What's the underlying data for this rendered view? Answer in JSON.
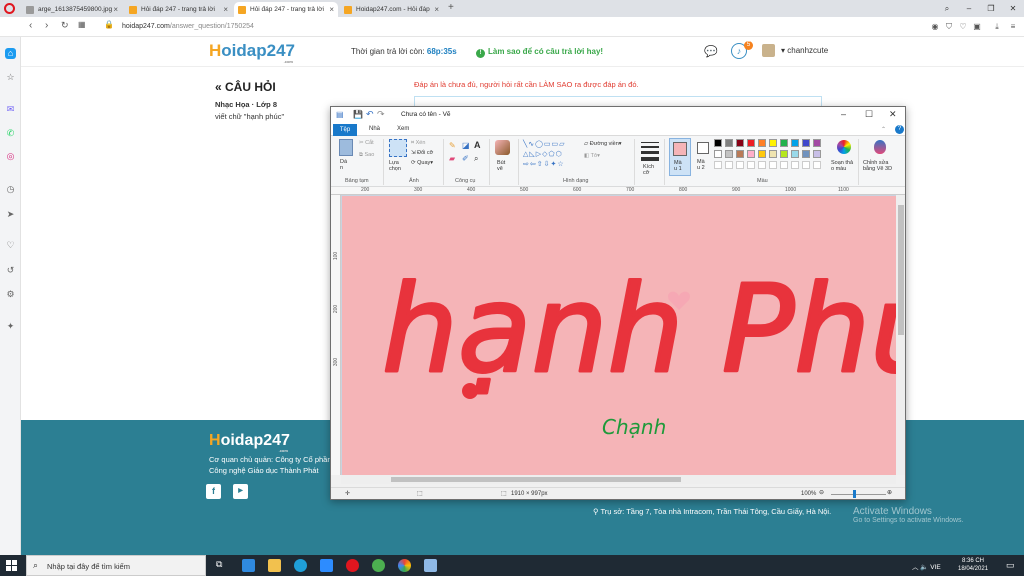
{
  "browser": {
    "tabs": [
      {
        "label": "arge_1613875459800.jpg",
        "active": false
      },
      {
        "label": "Hỏi đáp 247 - trang trả lời",
        "active": false
      },
      {
        "label": "Hỏi đáp 247 - trang trả lời",
        "active": true
      },
      {
        "label": "Hoidap247.com - Hỏi đáp",
        "active": false
      }
    ],
    "url_domain": "hoidap247.com",
    "url_path": "/answer_question/1750254"
  },
  "site": {
    "logo_h": "H",
    "logo_rest": "oidap247",
    "logo_com": ".com",
    "timer_label": "Thời gian trả lời còn:",
    "timer_value": "68p:35s",
    "tip": "Làm sao để có câu trả lời hay!",
    "notification_count": "5",
    "username": "chanhzcute"
  },
  "question": {
    "section_title": "CÂU HỎI",
    "subject": "Nhạc Họa · Lớp 8",
    "text": "viết chữ \"hạnh phúc\"",
    "warning": "Đáp án là chưa đủ, người hỏi rất cần LÀM SAO ra được đáp án đó."
  },
  "footer": {
    "logo_h": "H",
    "logo_rest": "oidap247",
    "logo_com": ".com",
    "owner": "Cơ quan chủ quản: Công ty Cổ phần Công nghệ Giáo dục Thành Phát",
    "address": "Trụ sở: Tầng 7, Tòa nhà Intracom, Trần Thái Tông, Cầu Giấy, Hà Nội.",
    "activate_title": "Activate Windows",
    "activate_sub": "Go to Settings to activate Windows."
  },
  "paint": {
    "title": "Chưa có tên - Vẽ",
    "tabs": {
      "file": "Tệp",
      "home": "Nhà",
      "view": "Xem"
    },
    "ribbon": {
      "paste": "Dá\nn",
      "cut": "Cắt",
      "copy": "Sao",
      "select": "Lựa\nchọn",
      "crop": "Xén",
      "resize": "Đổi cỡ",
      "rotate": "Quay",
      "brushes": "Bút\nvẽ",
      "outline": "Đường viền",
      "fill": "Tô",
      "size": "Kích\ncỡ",
      "color1": "Mà\nu 1",
      "color2": "Mà\nu 2",
      "edit_colors": "Soạn thả\no màu",
      "paint3d": "Chỉnh sửa\nbằng Vẽ 3D",
      "group_clipboard": "Bảng tạm",
      "group_image": "Ảnh",
      "group_tools": "Công cụ",
      "group_shapes": "Hình dạng",
      "group_colors": "Màu"
    },
    "ruler_ticks": [
      "200",
      "300",
      "400",
      "500",
      "600",
      "700",
      "800",
      "900",
      "1000",
      "1100"
    ],
    "vruler_ticks": [
      "100",
      "200",
      "300"
    ],
    "canvas_text": "hạnh Phúc",
    "signature": "Chạnh",
    "canvas_size": "1910 × 997px",
    "zoom": "100%",
    "palette_row1": [
      "#000000",
      "#7f7f7f",
      "#880015",
      "#ed1c24",
      "#ff7f27",
      "#fff200",
      "#22b14c",
      "#00a2e8",
      "#3f48cc",
      "#a349a4"
    ],
    "palette_row2": [
      "#ffffff",
      "#c3c3c3",
      "#b97a57",
      "#ffaec9",
      "#ffc90e",
      "#efe4b0",
      "#b5e61d",
      "#99d9ea",
      "#7092be",
      "#c8bfe7"
    ],
    "color1_value": "#f5b4b7",
    "color2_value": "#ffffff",
    "ink_color": "#e8333c",
    "signature_color": "#1e9a3a",
    "canvas_color": "#f5b4b7"
  },
  "taskbar": {
    "search_placeholder": "Nhập tại đây để tìm kiếm",
    "time": "8:36 CH",
    "date": "18/04/2021",
    "lang": "VIE"
  },
  "colors": {
    "footer_bg": "#2c7f93",
    "accent_blue": "#1979ca",
    "logo_orange": "#f5a623",
    "logo_blue": "#3a8fc3"
  }
}
